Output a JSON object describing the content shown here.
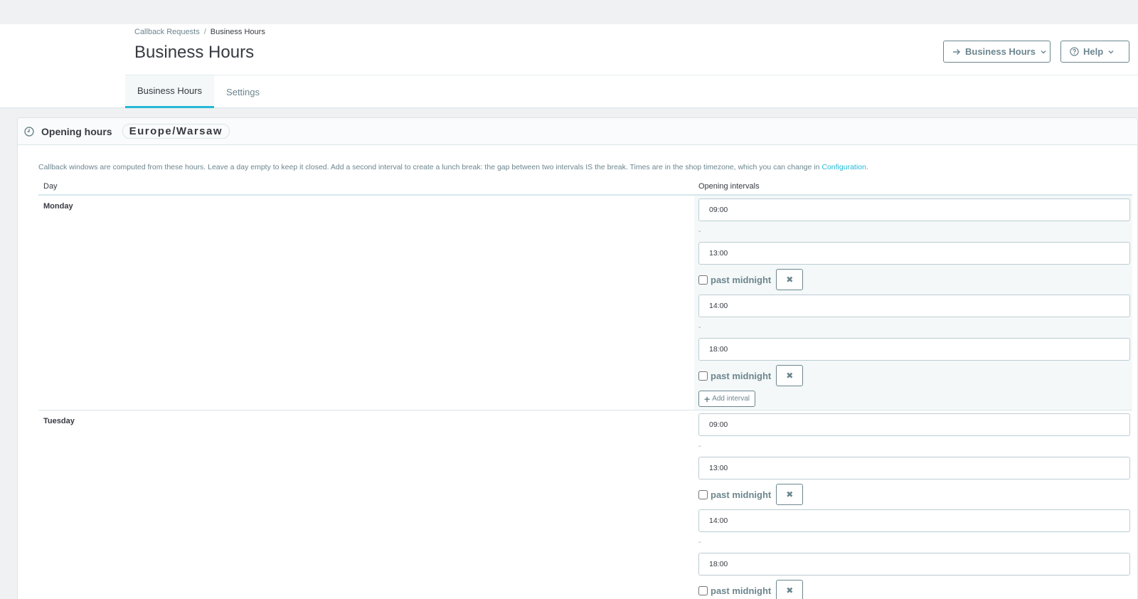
{
  "breadcrumb": {
    "parent": "Callback Requests",
    "separator": "/",
    "current": "Business Hours"
  },
  "page_title": "Business Hours",
  "toolbar": {
    "business_hours_label": "Business Hours",
    "help_label": "Help"
  },
  "tabs": [
    {
      "label": "Business Hours",
      "active": true
    },
    {
      "label": "Settings",
      "active": false
    }
  ],
  "card": {
    "title": "Opening hours",
    "timezone": "Europe/Warsaw",
    "help_text": "Callback windows are computed from these hours. Leave a day empty to keep it closed. Add a second interval to create a lunch break: the gap between two intervals IS the break. Times are in the shop timezone, which you can change in ",
    "help_link": "Configuration",
    "help_end": "."
  },
  "table": {
    "col_day": "Day",
    "col_intervals": "Opening intervals",
    "dash": "-",
    "past_midnight_label": "past midnight",
    "remove_symbol": "✖",
    "add_interval_label": "Add interval",
    "days": [
      {
        "name": "Monday",
        "intervals": [
          {
            "from": "09:00",
            "to": "13:00"
          },
          {
            "from": "14:00",
            "to": "18:00"
          }
        ]
      },
      {
        "name": "Tuesday",
        "intervals": [
          {
            "from": "09:00",
            "to": "13:00"
          },
          {
            "from": "14:00",
            "to": "18:00"
          }
        ]
      }
    ]
  },
  "colors": {
    "accent": "#25b9d7",
    "text": "#363a41",
    "muted": "#6c868e",
    "border": "#bbcdd2",
    "background": "#eff1f2"
  }
}
